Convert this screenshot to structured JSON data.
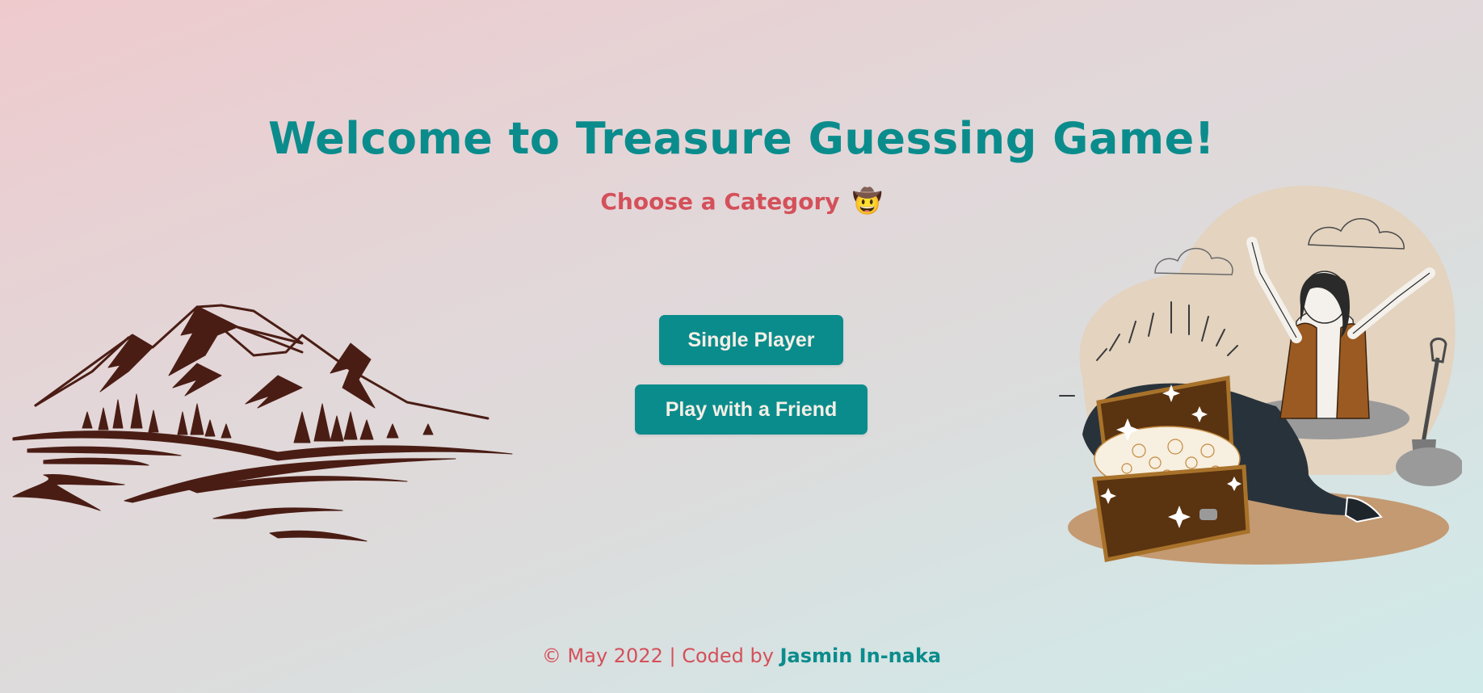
{
  "header": {
    "title": "Welcome to Treasure Guessing Game!",
    "subtitle": "Choose a Category",
    "subtitle_emoji": "🤠"
  },
  "menu": {
    "single_player_label": "Single Player",
    "friend_label": "Play with a Friend"
  },
  "footer": {
    "text": "© May 2022 | Coded by",
    "author": "Jasmin In-naka"
  },
  "illustrations": {
    "left": "mountains-illustration",
    "right": "treasure-hunter-illustration"
  },
  "colors": {
    "accent": "#0b8c8c",
    "secondary": "#d4505a",
    "button_text": "#f4efe6",
    "mountain": "#4a1d14",
    "chest": "#5a3310"
  }
}
